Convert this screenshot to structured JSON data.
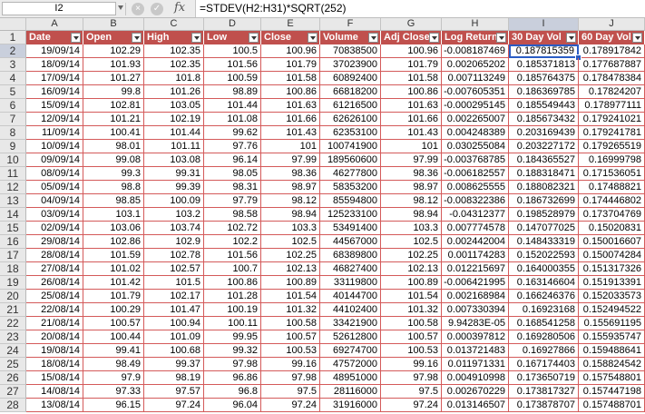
{
  "formula_bar": {
    "name_box": "I2",
    "cancel_icon": "×",
    "confirm_icon": "✓",
    "fx_label": "fx",
    "formula": "=STDEV(H2:H31)*SQRT(252)"
  },
  "columns": [
    "A",
    "B",
    "C",
    "D",
    "E",
    "F",
    "G",
    "H",
    "I",
    "J"
  ],
  "selected_column": "I",
  "headers": [
    "Date",
    "Open",
    "High",
    "Low",
    "Close",
    "Volume",
    "Adj Close",
    "Log Return",
    "30 Day Vol",
    "60 Day Vol"
  ],
  "rows": [
    {
      "n": "2",
      "cells": [
        "19/09/14",
        "102.29",
        "102.35",
        "100.5",
        "100.96",
        "70838500",
        "100.96",
        "-0.008187469",
        "0.187815359",
        "0.178917842"
      ]
    },
    {
      "n": "3",
      "cells": [
        "18/09/14",
        "101.93",
        "102.35",
        "101.56",
        "101.79",
        "37023900",
        "101.79",
        "0.002065202",
        "0.185371813",
        "0.177687887"
      ]
    },
    {
      "n": "4",
      "cells": [
        "17/09/14",
        "101.27",
        "101.8",
        "100.59",
        "101.58",
        "60892400",
        "101.58",
        "0.007113249",
        "0.185764375",
        "0.178478384"
      ]
    },
    {
      "n": "5",
      "cells": [
        "16/09/14",
        "99.8",
        "101.26",
        "98.89",
        "100.86",
        "66818200",
        "100.86",
        "-0.007605351",
        "0.186369785",
        "0.17824207"
      ]
    },
    {
      "n": "6",
      "cells": [
        "15/09/14",
        "102.81",
        "103.05",
        "101.44",
        "101.63",
        "61216500",
        "101.63",
        "-0.000295145",
        "0.185549443",
        "0.178977111"
      ]
    },
    {
      "n": "7",
      "cells": [
        "12/09/14",
        "101.21",
        "102.19",
        "101.08",
        "101.66",
        "62626100",
        "101.66",
        "0.002265007",
        "0.185673432",
        "0.179241021"
      ]
    },
    {
      "n": "8",
      "cells": [
        "11/09/14",
        "100.41",
        "101.44",
        "99.62",
        "101.43",
        "62353100",
        "101.43",
        "0.004248389",
        "0.203169439",
        "0.179241781"
      ]
    },
    {
      "n": "9",
      "cells": [
        "10/09/14",
        "98.01",
        "101.11",
        "97.76",
        "101",
        "100741900",
        "101",
        "0.030255084",
        "0.203227172",
        "0.179265519"
      ]
    },
    {
      "n": "10",
      "cells": [
        "09/09/14",
        "99.08",
        "103.08",
        "96.14",
        "97.99",
        "189560600",
        "97.99",
        "-0.003768785",
        "0.184365527",
        "0.16999798"
      ]
    },
    {
      "n": "11",
      "cells": [
        "08/09/14",
        "99.3",
        "99.31",
        "98.05",
        "98.36",
        "46277800",
        "98.36",
        "-0.006182557",
        "0.188318471",
        "0.171536051"
      ]
    },
    {
      "n": "12",
      "cells": [
        "05/09/14",
        "98.8",
        "99.39",
        "98.31",
        "98.97",
        "58353200",
        "98.97",
        "0.008625555",
        "0.188082321",
        "0.17488821"
      ]
    },
    {
      "n": "13",
      "cells": [
        "04/09/14",
        "98.85",
        "100.09",
        "97.79",
        "98.12",
        "85594800",
        "98.12",
        "-0.008322386",
        "0.186732699",
        "0.174446802"
      ]
    },
    {
      "n": "14",
      "cells": [
        "03/09/14",
        "103.1",
        "103.2",
        "98.58",
        "98.94",
        "125233100",
        "98.94",
        "-0.04312377",
        "0.198528979",
        "0.173704769"
      ]
    },
    {
      "n": "15",
      "cells": [
        "02/09/14",
        "103.06",
        "103.74",
        "102.72",
        "103.3",
        "53491400",
        "103.3",
        "0.007774578",
        "0.147077025",
        "0.15020831"
      ]
    },
    {
      "n": "16",
      "cells": [
        "29/08/14",
        "102.86",
        "102.9",
        "102.2",
        "102.5",
        "44567000",
        "102.5",
        "0.002442004",
        "0.148433319",
        "0.150016607"
      ]
    },
    {
      "n": "17",
      "cells": [
        "28/08/14",
        "101.59",
        "102.78",
        "101.56",
        "102.25",
        "68389800",
        "102.25",
        "0.001174283",
        "0.152022593",
        "0.150074284"
      ]
    },
    {
      "n": "18",
      "cells": [
        "27/08/14",
        "101.02",
        "102.57",
        "100.7",
        "102.13",
        "46827400",
        "102.13",
        "0.012215697",
        "0.164000355",
        "0.151317326"
      ]
    },
    {
      "n": "19",
      "cells": [
        "26/08/14",
        "101.42",
        "101.5",
        "100.86",
        "100.89",
        "33119800",
        "100.89",
        "-0.006421995",
        "0.163146604",
        "0.151913391"
      ]
    },
    {
      "n": "20",
      "cells": [
        "25/08/14",
        "101.79",
        "102.17",
        "101.28",
        "101.54",
        "40144700",
        "101.54",
        "0.002168984",
        "0.166246376",
        "0.152033573"
      ]
    },
    {
      "n": "21",
      "cells": [
        "22/08/14",
        "100.29",
        "101.47",
        "100.19",
        "101.32",
        "44102400",
        "101.32",
        "0.007330394",
        "0.16923168",
        "0.152494522"
      ]
    },
    {
      "n": "22",
      "cells": [
        "21/08/14",
        "100.57",
        "100.94",
        "100.11",
        "100.58",
        "33421900",
        "100.58",
        "9.94283E-05",
        "0.168541258",
        "0.155691195"
      ]
    },
    {
      "n": "23",
      "cells": [
        "20/08/14",
        "100.44",
        "101.09",
        "99.95",
        "100.57",
        "52612800",
        "100.57",
        "0.000397812",
        "0.169280506",
        "0.155935747"
      ]
    },
    {
      "n": "24",
      "cells": [
        "19/08/14",
        "99.41",
        "100.68",
        "99.32",
        "100.53",
        "69274700",
        "100.53",
        "0.013721483",
        "0.16927866",
        "0.159488641"
      ]
    },
    {
      "n": "25",
      "cells": [
        "18/08/14",
        "98.49",
        "99.37",
        "97.98",
        "99.16",
        "47572000",
        "99.16",
        "0.011971331",
        "0.167174403",
        "0.158824542"
      ]
    },
    {
      "n": "26",
      "cells": [
        "15/08/14",
        "97.9",
        "98.19",
        "96.86",
        "97.98",
        "48951000",
        "97.98",
        "0.004910998",
        "0.173650719",
        "0.157548801"
      ]
    },
    {
      "n": "27",
      "cells": [
        "14/08/14",
        "97.33",
        "97.57",
        "96.8",
        "97.5",
        "28116000",
        "97.5",
        "0.002670229",
        "0.173817327",
        "0.157447198"
      ]
    },
    {
      "n": "28",
      "cells": [
        "13/08/14",
        "96.15",
        "97.24",
        "96.04",
        "97.24",
        "31916000",
        "97.24",
        "0.013146507",
        "0.173878707",
        "0.157488701"
      ]
    }
  ],
  "header_row_number": "1",
  "colors": {
    "header_bg": "#c0504d",
    "grid_line": "#d45a5a",
    "selection": "#2a5cc4"
  }
}
